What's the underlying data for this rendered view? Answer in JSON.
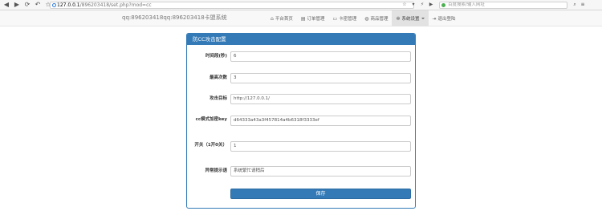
{
  "browser": {
    "url_host": "127.0.0.1",
    "url_rest": "/896203418/set.php?mod=cc",
    "search_placeholder": "百度搜索/输入网址"
  },
  "site": {
    "brand": "qq:896203418qq:896203418卡盟系统",
    "nav": [
      {
        "label": "平台首页",
        "icon": "home-icon"
      },
      {
        "label": "订单管理",
        "icon": "list-icon"
      },
      {
        "label": "卡密管理",
        "icon": "card-icon"
      },
      {
        "label": "商品管理",
        "icon": "globe-icon"
      },
      {
        "label": "系统设置",
        "icon": "gear-icon",
        "active": true
      },
      {
        "label": "退出登陆",
        "icon": "logout-icon"
      }
    ]
  },
  "panel": {
    "title": "防CC攻击配置",
    "fields": [
      {
        "label": "时间段(秒)",
        "value": "6"
      },
      {
        "label": "最高次数",
        "value": "3"
      },
      {
        "label": "攻击目标",
        "value": "http://127.0.0.1/"
      },
      {
        "label": "cc模式加密key",
        "value": "d64333a43a3f457814a4b6318f3333ef"
      },
      {
        "label": "开关（1开0关）",
        "value": "1"
      },
      {
        "label": "异常提示语",
        "value": "系统繁忙请稍后"
      }
    ],
    "submit_label": "保存"
  },
  "colors": {
    "primary": "#337ab7",
    "navbar_bg": "#f8f8f8"
  }
}
